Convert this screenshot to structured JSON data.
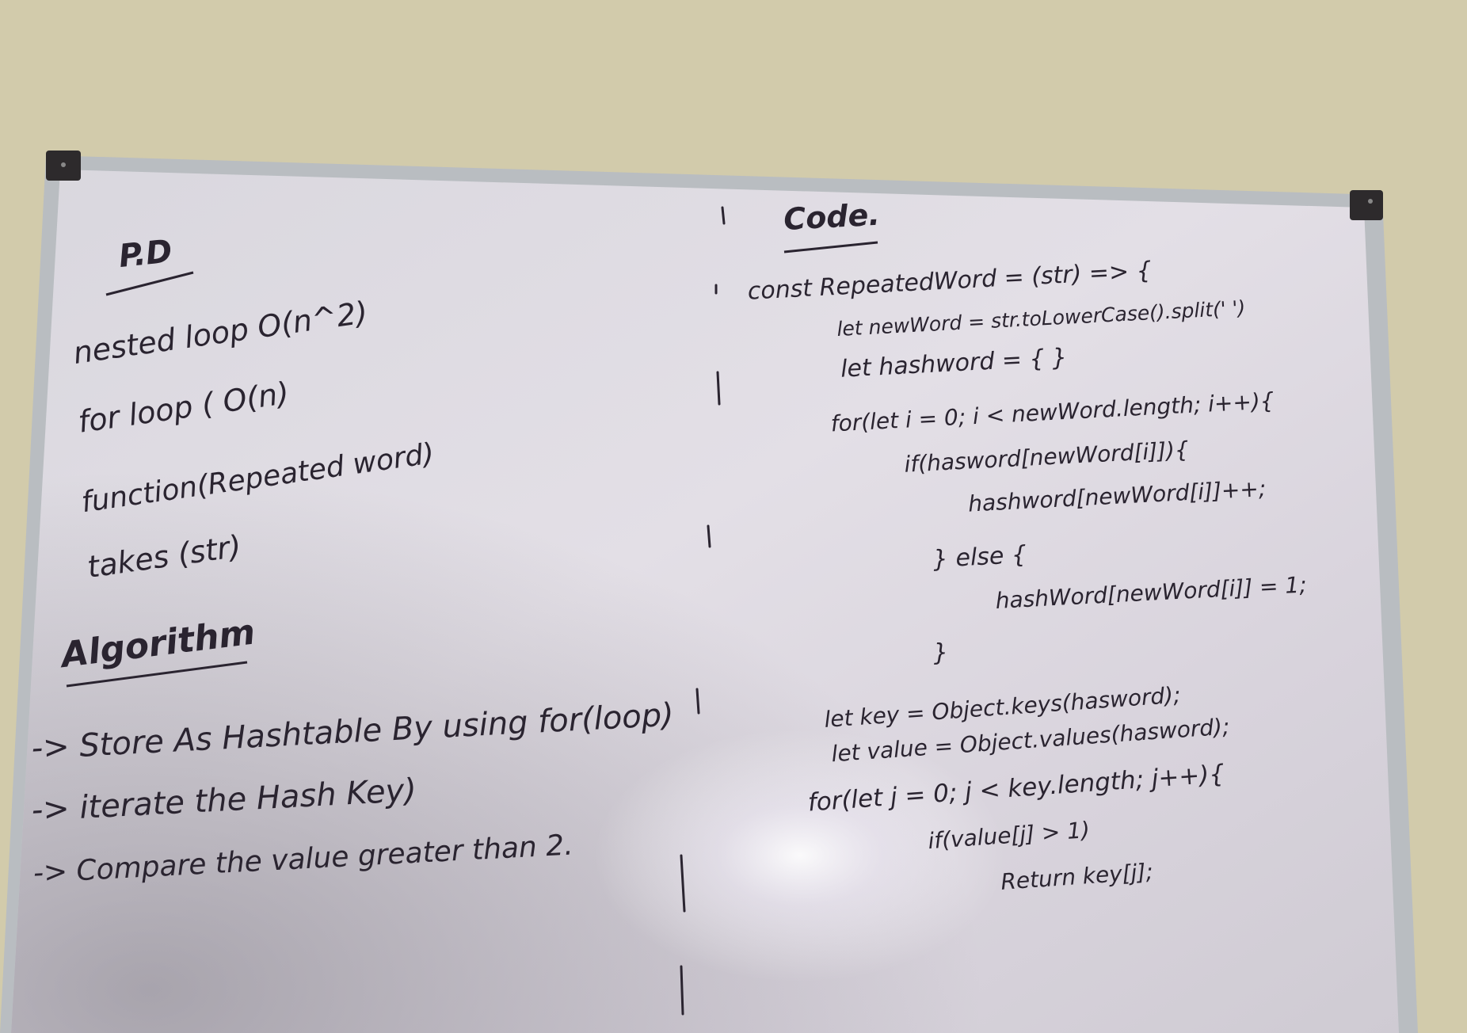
{
  "left": {
    "pd_heading": "P.D",
    "pd_lines": [
      "nested loop O(n^2)",
      "for loop ( O(n)",
      "function(Repeated word)",
      "takes (str)"
    ],
    "algorithm_heading": "Algorithm",
    "algorithm_steps": [
      "-> Store As Hashtable By using for(loop)",
      "-> iterate the Hash Key)",
      "-> Compare the value greater than 2."
    ]
  },
  "right": {
    "code_heading": "Code.",
    "code_lines": [
      "const RepeatedWord = (str) => {",
      "let newWord = str.toLowerCase().split(' ')",
      "let hashword = { }",
      "for(let i = 0; i < newWord.length; i++){",
      "if(hasword[newWord[i]]){",
      "hashword[newWord[i]]++;",
      "} else {",
      "hashWord[newWord[i]] = 1;",
      "}",
      "let key = Object.keys(hasword);",
      "let value = Object.values(hasword);",
      "for(let j = 0; j < key.length; j++){",
      "if(value[j] > 1)",
      "Return key[j];"
    ]
  },
  "colors": {
    "wall": "#d2cbab",
    "board": "#e6e2e6",
    "frame": "#b8bcc0",
    "ink": "#2a2430"
  }
}
